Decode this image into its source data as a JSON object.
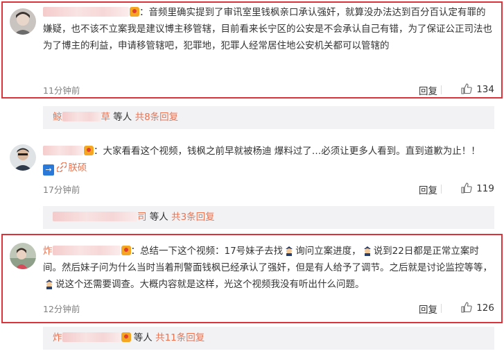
{
  "comments": [
    {
      "text": "：音频里确实提到了审讯室里钱枫亲口承认强奸，就算没办法达到百分百认定有罪的嫌疑，也不该不立案我是建议博主移管辖，目前看来长宁区的公安是不会承认自己有错，为了保证公正司法也为了博主的利益，申请移管辖吧，犯罪地，犯罪人经常居住地公安机关都可以管辖的",
      "time": "11分钟前",
      "reply_label": "回复",
      "likes": "134"
    },
    {
      "text_a": "：大家看看这个视频，钱枫之前早就被杨迪 爆料过了…必须让更多人看到。直到道歉为止！！",
      "link_label": "朕硕",
      "time": "17分钟前",
      "reply_label": "回复",
      "likes": "119"
    },
    {
      "text_a": "：总结一下这个视频：17号妹子去找",
      "text_b": "询问立案进度，",
      "text_c": "说到22日都是正常立案时间。然后妹子问为什么当时当着刑警面钱枫已经承认了强奸，但是有人给予了调节。之后就是讨论监控等等，",
      "text_d": "说这个还需要调查。大概内容就是这样，光这个视频我没有听出什么问题。",
      "time": "12分钟前",
      "reply_label": "回复",
      "likes": "126"
    }
  ],
  "subbars": [
    {
      "name_prefix": "鲸",
      "name_suffix": "草",
      "others": "等人",
      "more": "共8条回复"
    },
    {
      "name_prefix": "",
      "name_suffix": "司",
      "others": "等人",
      "more": "共3条回复"
    },
    {
      "name_prefix": "炸",
      "name_suffix": "",
      "others": "等人",
      "more": "共11条回复"
    }
  ],
  "user_prefix_3": "炸",
  "colors": {
    "accent": "#eb7350",
    "highlight": "#d9343b",
    "subbar_bg": "#f2f2f5"
  }
}
